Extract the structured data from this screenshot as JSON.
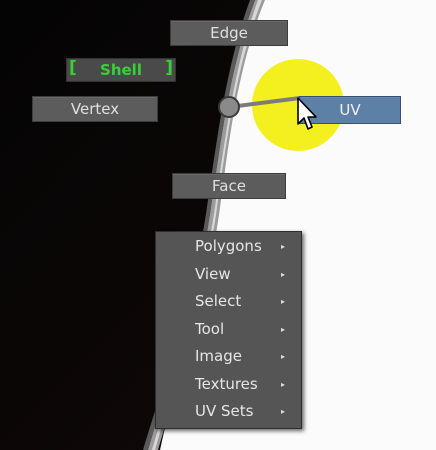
{
  "marking_menu": {
    "north_label": "Edge",
    "west_label": "Vertex",
    "northwest_label": "Shell",
    "east_label": "UV",
    "south_label": "Face"
  },
  "context_menu": {
    "items": [
      {
        "label": "Polygons"
      },
      {
        "label": "View"
      },
      {
        "label": "Select"
      },
      {
        "label": "Tool"
      },
      {
        "label": "Image"
      },
      {
        "label": "Textures"
      },
      {
        "label": "UV Sets"
      }
    ]
  },
  "colors": {
    "highlight": "#5d80a6",
    "shell_text": "#37d037",
    "cursor_highlight": "#f4ef1f"
  }
}
